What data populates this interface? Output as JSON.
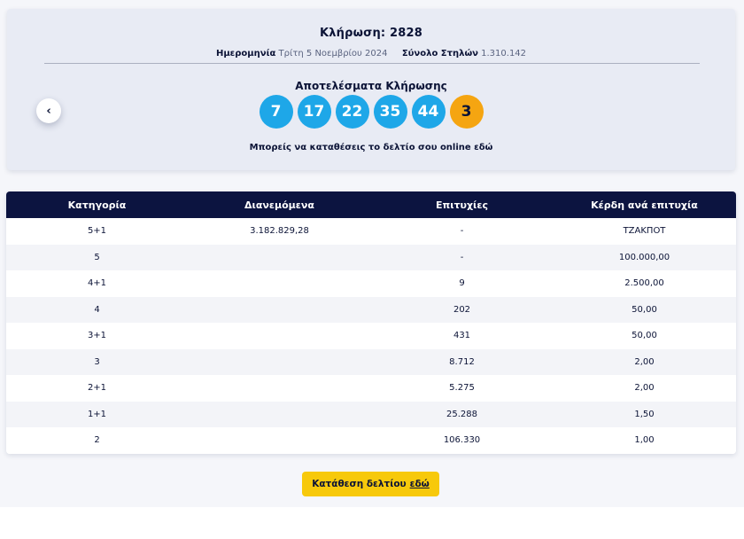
{
  "draw": {
    "title": "Κλήρωση: 2828",
    "date_label": "Ημερομηνία",
    "date_value": "Τρίτη 5 Νοεμβρίου 2024",
    "columns_label": "Σύνολο Στηλών",
    "columns_value": "1.310.142",
    "results_title": "Αποτελέσματα Κλήρωσης",
    "numbers": [
      "7",
      "17",
      "22",
      "35",
      "44"
    ],
    "bonus": "3",
    "online_text": "Μπορείς να καταθέσεις το δελτίο σου online",
    "online_link": "εδώ",
    "prev_icon": "‹"
  },
  "table": {
    "headers": [
      "Κατηγορία",
      "Διανεμόμενα",
      "Επιτυχίες",
      "Κέρδη ανά επιτυχία"
    ],
    "rows": [
      [
        "5+1",
        "3.182.829,28",
        "-",
        "ΤΖΑΚΠΟΤ"
      ],
      [
        "5",
        "",
        "-",
        "100.000,00"
      ],
      [
        "4+1",
        "",
        "9",
        "2.500,00"
      ],
      [
        "4",
        "",
        "202",
        "50,00"
      ],
      [
        "3+1",
        "",
        "431",
        "50,00"
      ],
      [
        "3",
        "",
        "8.712",
        "2,00"
      ],
      [
        "2+1",
        "",
        "5.275",
        "2,00"
      ],
      [
        "1+1",
        "",
        "25.288",
        "1,50"
      ],
      [
        "2",
        "",
        "106.330",
        "1,00"
      ]
    ]
  },
  "submit": {
    "label": "Κατάθεση δελτίου",
    "link": "εδώ"
  },
  "colors": {
    "ball": "#1ea7e8",
    "bonus_ball": "#f5a511",
    "header_bg": "#0c1440",
    "button": "#f7c90b"
  }
}
